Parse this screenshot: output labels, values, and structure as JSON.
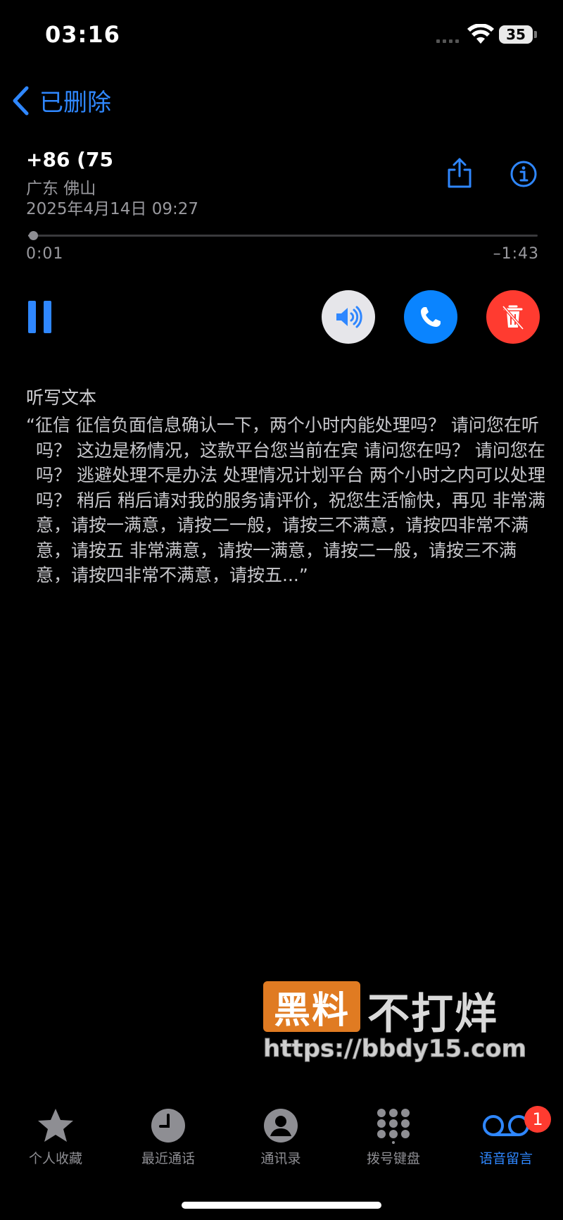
{
  "status_bar": {
    "time": "03:16",
    "battery": "35"
  },
  "nav": {
    "back_label": "已删除"
  },
  "voicemail": {
    "number": "+86 (75",
    "location": "广东 佛山",
    "date": "2025年4月14日 09:27"
  },
  "playback": {
    "elapsed": "0:01",
    "remaining": "–1:43",
    "progress": 0.0096
  },
  "transcript": {
    "title": "听写文本",
    "text": "“征信 征信负面信息确认一下，两个小时内能处理吗？ 请问您在听吗？ 这边是杨情况，这款平台您当前在宾 请问您在吗？ 请问您在吗？ 逃避处理不是办法 处理情况计划平台 两个小时之内可以处理吗？ 稍后 稍后请对我的服务请评价，祝您生活愉快，再见 非常满意，请按一满意，请按二一般，请按三不满意，请按四非常不满意，请按五 非常满意，请按一满意，请按二一般，请按三不满意，请按四非常不满意，请按五...”"
  },
  "watermark": {
    "logo": "黑料",
    "brand": "不打烊",
    "url": "https://bbdy15.com"
  },
  "tabs": [
    {
      "label": "个人收藏",
      "icon": "star-icon"
    },
    {
      "label": "最近通话",
      "icon": "clock-icon"
    },
    {
      "label": "通讯录",
      "icon": "person-icon"
    },
    {
      "label": "拨号键盘",
      "icon": "keypad-icon"
    },
    {
      "label": "语音留言",
      "icon": "voicemail-icon"
    }
  ],
  "tab_badge": "1",
  "colors": {
    "accent": "#2f87ff",
    "call": "#0a84ff",
    "delete": "#ff3b30",
    "speaker_bg": "#e6e6ea",
    "secondary_text": "#9a9a9f",
    "watermark_orange": "#e07b22"
  }
}
